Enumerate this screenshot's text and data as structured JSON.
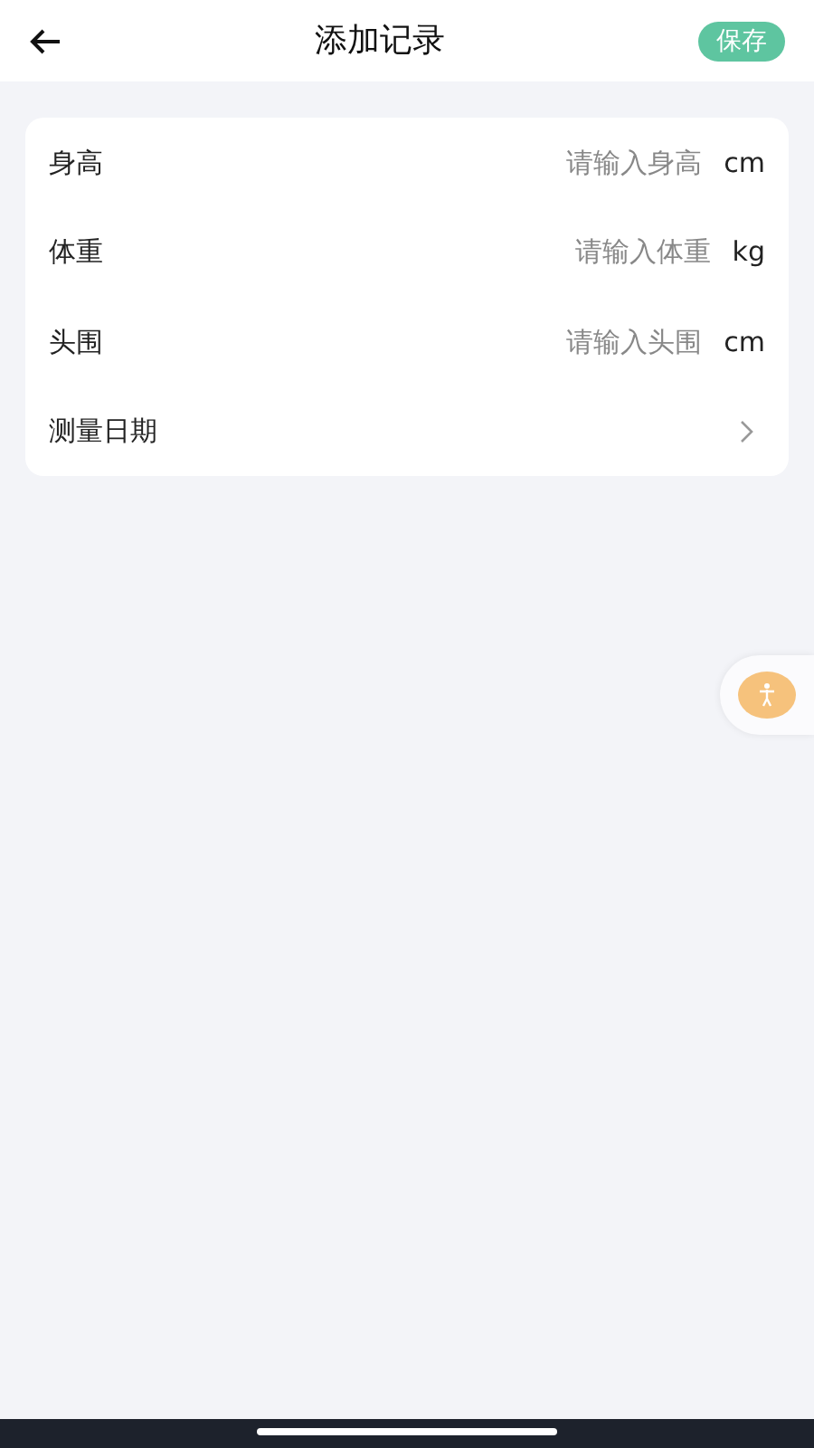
{
  "header": {
    "title": "添加记录",
    "save": "保存"
  },
  "fields": [
    {
      "kind": "input",
      "label": "身高",
      "placeholder": "请输入身高",
      "unit": "cm"
    },
    {
      "kind": "input",
      "label": "体重",
      "placeholder": "请输入体重",
      "unit": "kg"
    },
    {
      "kind": "input",
      "label": "头围",
      "placeholder": "请输入头围",
      "unit": "cm"
    },
    {
      "kind": "select",
      "label": "测量日期"
    }
  ]
}
